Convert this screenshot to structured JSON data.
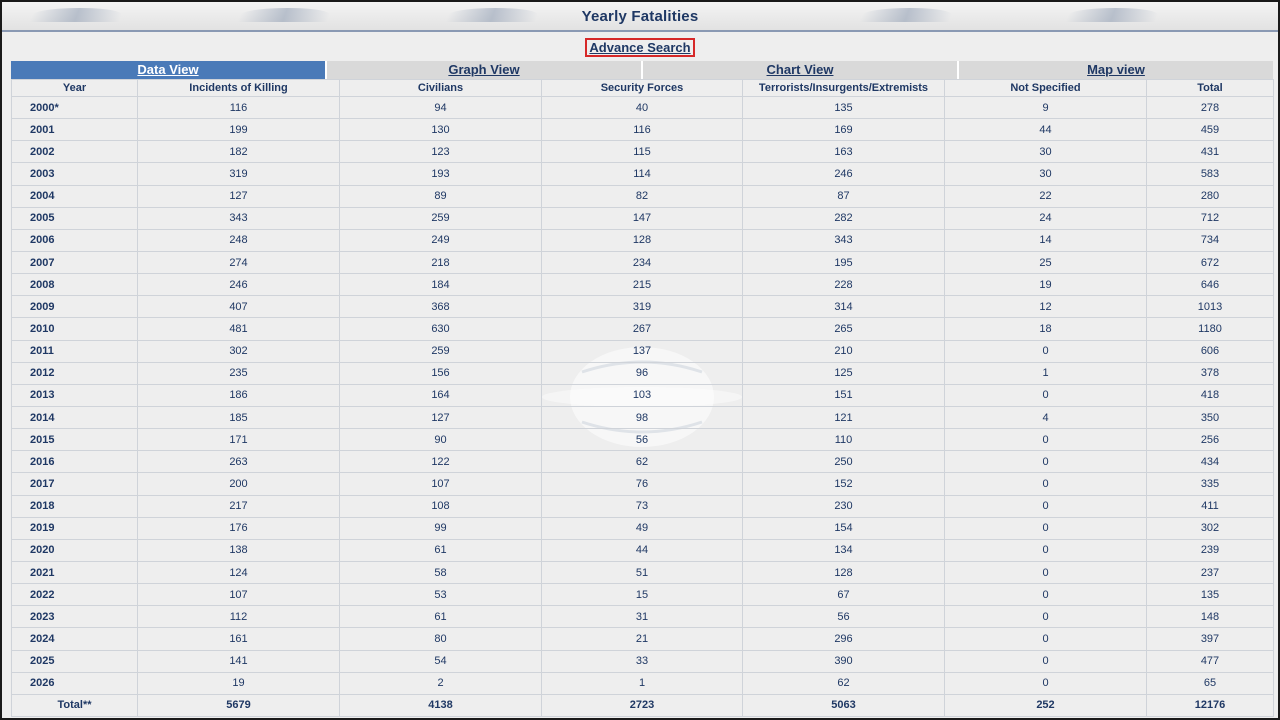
{
  "header": {
    "title": "Yearly Fatalities"
  },
  "advance_search": {
    "label": "Advance Search"
  },
  "tabs": [
    {
      "label": "Data View",
      "active": true
    },
    {
      "label": "Graph View",
      "active": false
    },
    {
      "label": "Chart View",
      "active": false
    },
    {
      "label": "Map view",
      "active": false
    }
  ],
  "table": {
    "columns": [
      "Year",
      "Incidents of Killing",
      "Civilians",
      "Security Forces",
      "Terrorists/Insurgents/Extremists",
      "Not Specified",
      "Total"
    ],
    "rows": [
      [
        "2000*",
        "116",
        "94",
        "40",
        "135",
        "9",
        "278"
      ],
      [
        "2001",
        "199",
        "130",
        "116",
        "169",
        "44",
        "459"
      ],
      [
        "2002",
        "182",
        "123",
        "115",
        "163",
        "30",
        "431"
      ],
      [
        "2003",
        "319",
        "193",
        "114",
        "246",
        "30",
        "583"
      ],
      [
        "2004",
        "127",
        "89",
        "82",
        "87",
        "22",
        "280"
      ],
      [
        "2005",
        "343",
        "259",
        "147",
        "282",
        "24",
        "712"
      ],
      [
        "2006",
        "248",
        "249",
        "128",
        "343",
        "14",
        "734"
      ],
      [
        "2007",
        "274",
        "218",
        "234",
        "195",
        "25",
        "672"
      ],
      [
        "2008",
        "246",
        "184",
        "215",
        "228",
        "19",
        "646"
      ],
      [
        "2009",
        "407",
        "368",
        "319",
        "314",
        "12",
        "1013"
      ],
      [
        "2010",
        "481",
        "630",
        "267",
        "265",
        "18",
        "1180"
      ],
      [
        "2011",
        "302",
        "259",
        "137",
        "210",
        "0",
        "606"
      ],
      [
        "2012",
        "235",
        "156",
        "96",
        "125",
        "1",
        "378"
      ],
      [
        "2013",
        "186",
        "164",
        "103",
        "151",
        "0",
        "418"
      ],
      [
        "2014",
        "185",
        "127",
        "98",
        "121",
        "4",
        "350"
      ],
      [
        "2015",
        "171",
        "90",
        "56",
        "110",
        "0",
        "256"
      ],
      [
        "2016",
        "263",
        "122",
        "62",
        "250",
        "0",
        "434"
      ],
      [
        "2017",
        "200",
        "107",
        "76",
        "152",
        "0",
        "335"
      ],
      [
        "2018",
        "217",
        "108",
        "73",
        "230",
        "0",
        "411"
      ],
      [
        "2019",
        "176",
        "99",
        "49",
        "154",
        "0",
        "302"
      ],
      [
        "2020",
        "138",
        "61",
        "44",
        "134",
        "0",
        "239"
      ],
      [
        "2021",
        "124",
        "58",
        "51",
        "128",
        "0",
        "237"
      ],
      [
        "2022",
        "107",
        "53",
        "15",
        "67",
        "0",
        "135"
      ],
      [
        "2023",
        "112",
        "61",
        "31",
        "56",
        "0",
        "148"
      ],
      [
        "2024",
        "161",
        "80",
        "21",
        "296",
        "0",
        "397"
      ],
      [
        "2025",
        "141",
        "54",
        "33",
        "390",
        "0",
        "477"
      ],
      [
        "2026",
        "19",
        "2",
        "1",
        "62",
        "0",
        "65"
      ]
    ],
    "total": [
      "Total**",
      "5679",
      "4138",
      "2723",
      "5063",
      "252",
      "12176"
    ]
  },
  "colors": {
    "text": "#1f3864",
    "active_tab": "#4a7ab8",
    "inactive_tab": "#d9d9d9",
    "highlight_border": "#d62828",
    "background": "#eeeeee"
  }
}
